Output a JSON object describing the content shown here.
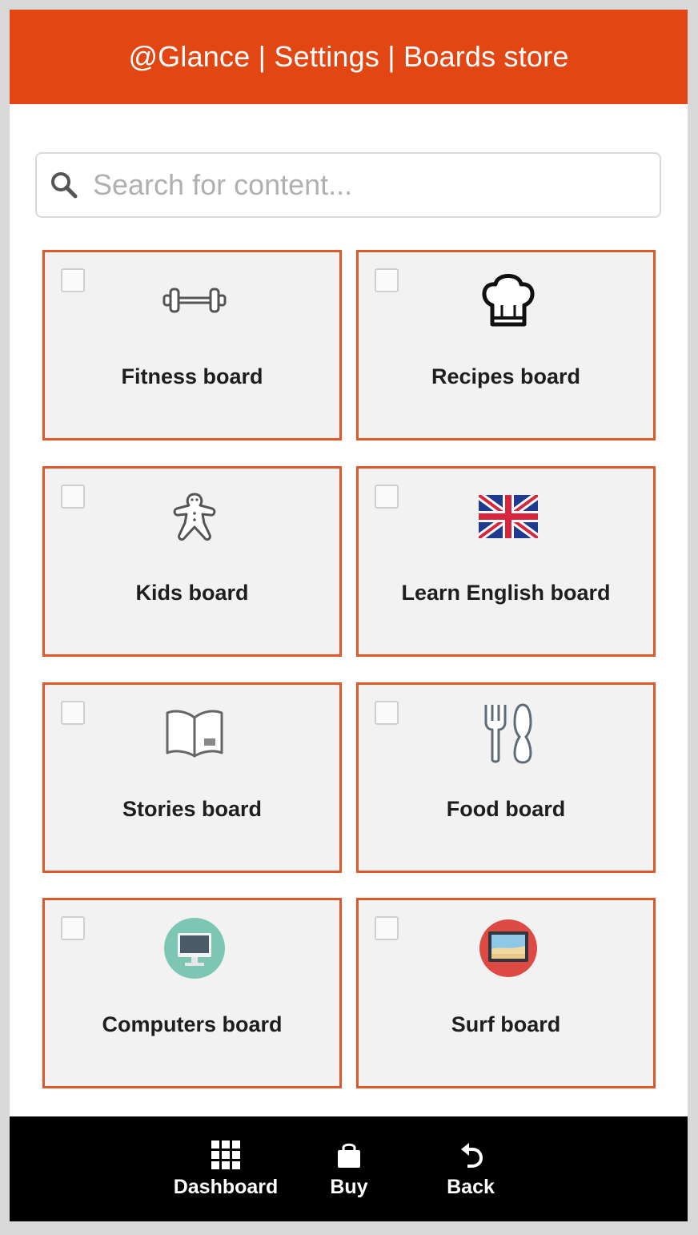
{
  "header": {
    "title": "@Glance | Settings | Boards store"
  },
  "search": {
    "placeholder": "Search for content...",
    "icon": "search-icon"
  },
  "boards": [
    {
      "label": "Fitness board",
      "icon": "dumbbell-icon",
      "checked": false
    },
    {
      "label": "Recipes board",
      "icon": "chef-hat-icon",
      "checked": false
    },
    {
      "label": "Kids board",
      "icon": "gingerbread-man-icon",
      "checked": false
    },
    {
      "label": "Learn English board",
      "icon": "uk-flag-icon",
      "checked": false
    },
    {
      "label": "Stories board",
      "icon": "open-book-icon",
      "checked": false
    },
    {
      "label": "Food board",
      "icon": "fork-spoon-icon",
      "checked": false
    },
    {
      "label": "Computers board",
      "icon": "computer-monitor-icon",
      "checked": false
    },
    {
      "label": "Surf board",
      "icon": "beach-picture-icon",
      "checked": false
    }
  ],
  "footer": {
    "dashboard": "Dashboard",
    "buy": "Buy",
    "back": "Back"
  },
  "colors": {
    "header": "#e24612",
    "card_border": "#e0582a",
    "card_bg": "#f2f2f2",
    "footer": "#000000"
  }
}
